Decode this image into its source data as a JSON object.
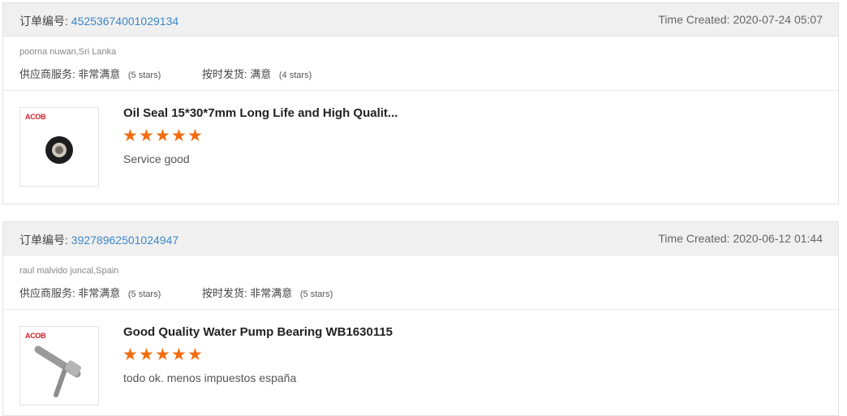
{
  "accent_color": "#3d86c6",
  "star_color": "#f36c0f",
  "orders": [
    {
      "order_label": "订单编号:",
      "order_number": "45253674001029134",
      "time_created": "Time Created: 2020-07-24 05:07",
      "buyer": "poorna nuwan,Sri Lanka",
      "service_label": "供应商服务:",
      "service_value": "非常满意",
      "service_stars": "(5 stars)",
      "shipping_label": "按时发货:",
      "shipping_value": "满意",
      "shipping_stars": "(4 stars)",
      "product_logo": "ACOB",
      "product_title": "Oil Seal 15*30*7mm Long Life and High Qualit...",
      "rating": 5,
      "comment": "Service good"
    },
    {
      "order_label": "订单编号:",
      "order_number": "39278962501024947",
      "time_created": "Time Created: 2020-06-12 01:44",
      "buyer": "raul malvido juncal,Spain",
      "service_label": "供应商服务:",
      "service_value": "非常满意",
      "service_stars": "(5 stars)",
      "shipping_label": "按时发货:",
      "shipping_value": "非常满意",
      "shipping_stars": "(5 stars)",
      "product_logo": "ACOB",
      "product_title": "Good Quality Water Pump Bearing WB1630115",
      "rating": 5,
      "comment": "todo ok. menos impuestos españa"
    }
  ]
}
